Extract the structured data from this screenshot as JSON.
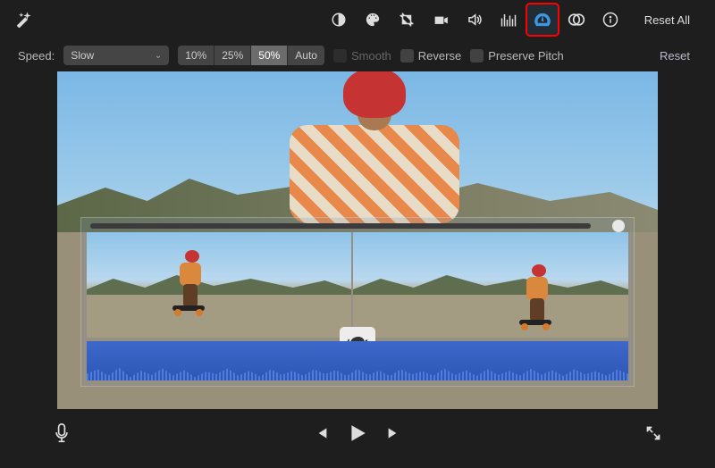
{
  "toolbar": {
    "reset_all_label": "Reset All",
    "icons": {
      "magic": "magic-wand-icon",
      "enhance": "contrast-icon",
      "color": "color-palette-icon",
      "crop": "crop-icon",
      "stabilize": "camera-icon",
      "volume": "speaker-icon",
      "noise": "equalizer-icon",
      "speed": "speedometer-icon",
      "color_filter": "overlap-circles-icon",
      "info": "info-icon"
    }
  },
  "speed_controls": {
    "label": "Speed:",
    "dropdown_value": "Slow",
    "presets": [
      "10%",
      "25%",
      "50%",
      "Auto"
    ],
    "active_preset": "50%",
    "smooth_label": "Smooth",
    "smooth_enabled": false,
    "reverse_label": "Reverse",
    "preserve_pitch_label": "Preserve Pitch",
    "reset_label": "Reset"
  },
  "clip": {
    "speed_indicator": "turtle"
  },
  "playback": {
    "mic": "microphone-icon",
    "prev": "prev-frame",
    "play": "play",
    "next": "next-frame",
    "fullscreen": "fullscreen"
  }
}
